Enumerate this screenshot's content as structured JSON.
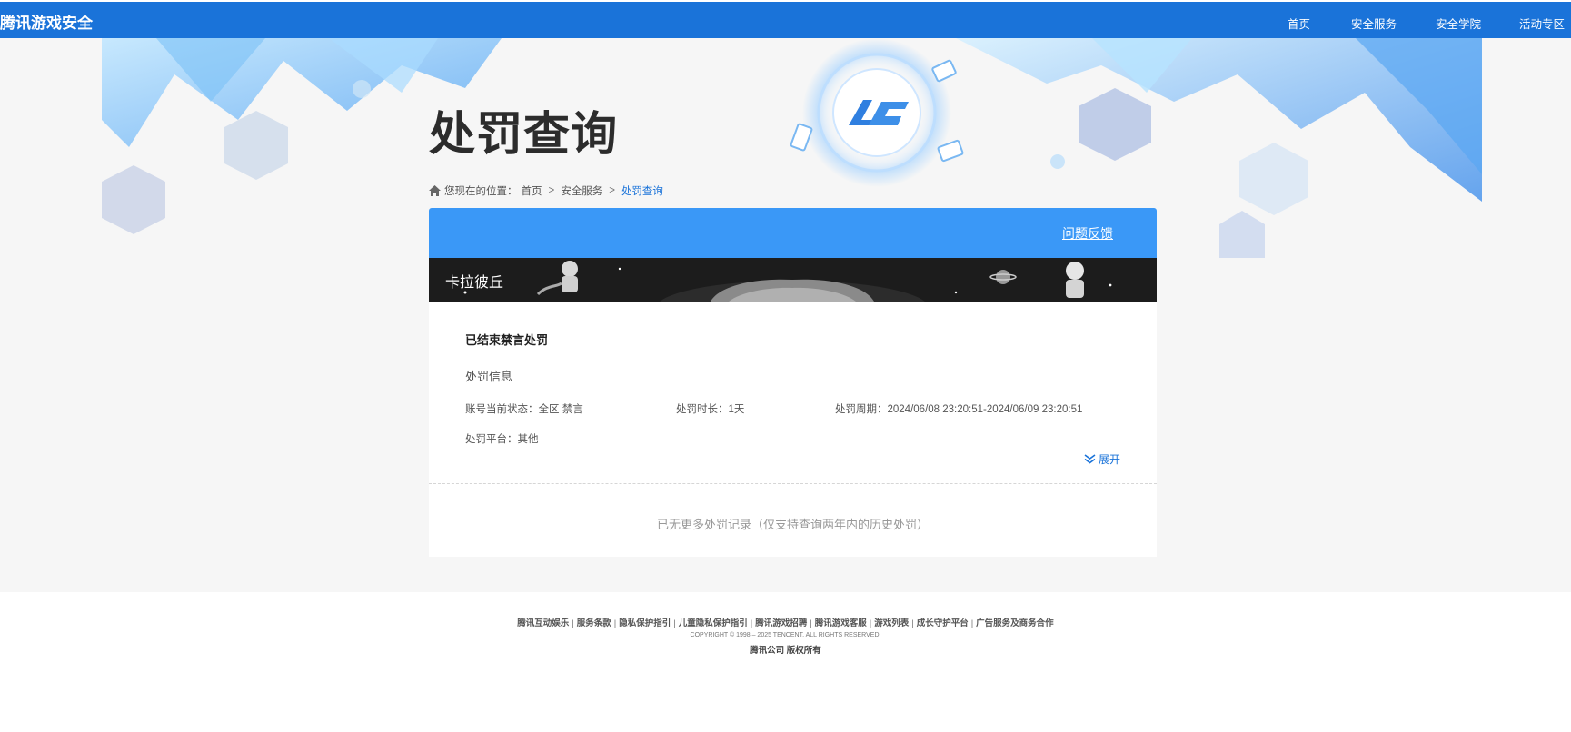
{
  "brand": {
    "name": "腾讯游戏安全"
  },
  "nav": {
    "items": [
      {
        "label": "首页"
      },
      {
        "label": "安全服务"
      },
      {
        "label": "安全学院"
      },
      {
        "label": "活动专区"
      }
    ]
  },
  "page": {
    "title": "处罚查询"
  },
  "breadcrumb": {
    "prefix": "您现在的位置：",
    "items": [
      "首页",
      "安全服务",
      "处罚查询"
    ],
    "sep": ">"
  },
  "panel": {
    "feedback_label": "问题反馈",
    "game_name": "卡拉彼丘",
    "record": {
      "status_title": "已结束禁言处罚",
      "section_label": "处罚信息",
      "account_status": "账号当前状态：全区 禁言",
      "duration": "处罚时长：1天",
      "period": "处罚周期：2024/06/08 23:20:51-2024/06/09 23:20:51",
      "platform": "处罚平台：其他",
      "expand_label": "展开"
    },
    "no_more_text": "已无更多处罚记录（仅支持查询两年内的历史处罚）"
  },
  "footer": {
    "links": [
      "腾讯互动娱乐",
      "服务条款",
      "隐私保护指引",
      "儿童隐私保护指引",
      "腾讯游戏招聘",
      "腾讯游戏客服",
      "游戏列表",
      "成长守护平台",
      "广告服务及商务合作"
    ],
    "copyright": "COPYRIGHT © 1998 – 2025 TENCENT. ALL RIGHTS RESERVED.",
    "company": "腾讯公司 版权所有"
  },
  "colors": {
    "topbar": "#1a73d9",
    "panel_header": "#3a98f7",
    "accent_link": "#1a73d9",
    "hero_bg": "#f6f6f6"
  },
  "icons": [
    "home-icon",
    "ace-logo-emblem",
    "chevron-double-down-icon"
  ]
}
